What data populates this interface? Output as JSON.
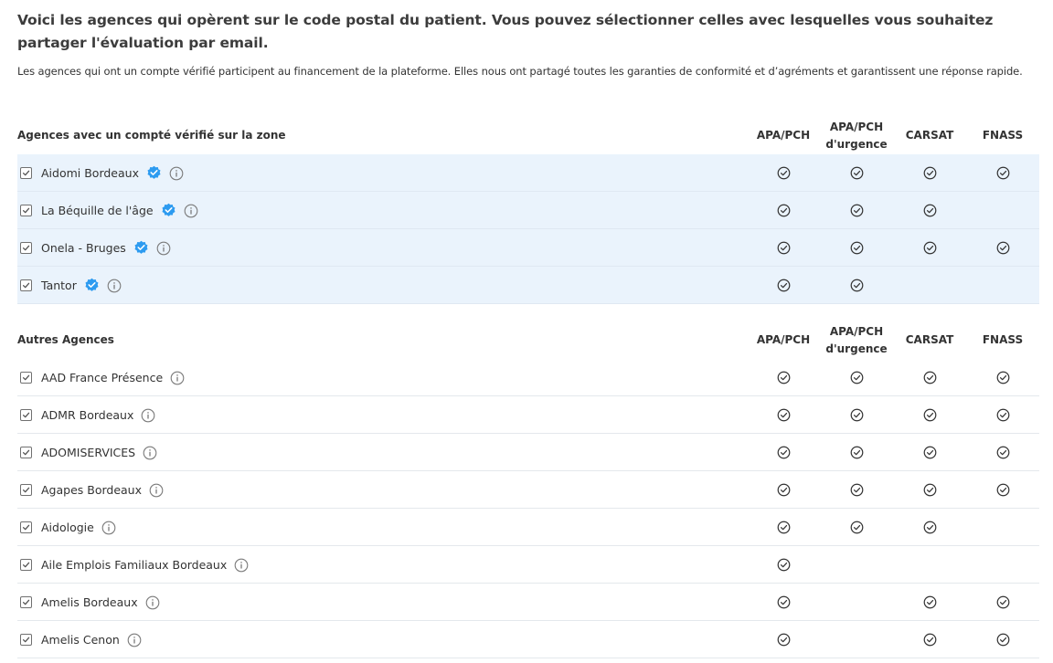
{
  "intro": {
    "title": "Voici les agences qui opèrent sur le code postal du patient. Vous pouvez sélectionner celles avec lesquelles vous souhaitez partager l'évaluation par email.",
    "text": "Les agences qui ont un compte vérifié participent au financement de la plateforme. Elles  nous ont partagé toutes les garanties de conformité et d’agréments et garantissent une réponse rapide."
  },
  "columns": [
    "APA/PCH",
    "APA/PCH d'urgence",
    "CARSAT",
    "FNASS"
  ],
  "verified_section": {
    "title": "Agences avec un compté vérifié sur la zone",
    "rows": [
      {
        "name": "Aidomi Bordeaux",
        "checked": true,
        "flags": [
          true,
          true,
          true,
          true
        ]
      },
      {
        "name": "La Béquille de l'âge",
        "checked": true,
        "flags": [
          true,
          true,
          true,
          false
        ]
      },
      {
        "name": "Onela - Bruges",
        "checked": true,
        "flags": [
          true,
          true,
          true,
          true
        ]
      },
      {
        "name": "Tantor",
        "checked": true,
        "flags": [
          true,
          true,
          false,
          false
        ]
      }
    ]
  },
  "other_section": {
    "title": "Autres Agences",
    "rows": [
      {
        "name": "AAD France Présence",
        "checked": true,
        "flags": [
          true,
          true,
          true,
          true
        ]
      },
      {
        "name": "ADMR Bordeaux",
        "checked": true,
        "flags": [
          true,
          true,
          true,
          true
        ]
      },
      {
        "name": "ADOMISERVICES",
        "checked": true,
        "flags": [
          true,
          true,
          true,
          true
        ]
      },
      {
        "name": "Agapes Bordeaux",
        "checked": true,
        "flags": [
          true,
          true,
          true,
          true
        ]
      },
      {
        "name": "Aidologie",
        "checked": true,
        "flags": [
          true,
          true,
          true,
          false
        ]
      },
      {
        "name": "Aile Emplois Familiaux Bordeaux",
        "checked": true,
        "flags": [
          true,
          false,
          false,
          false
        ]
      },
      {
        "name": "Amelis Bordeaux",
        "checked": true,
        "flags": [
          true,
          false,
          true,
          true
        ]
      },
      {
        "name": "Amelis Cenon",
        "checked": true,
        "flags": [
          true,
          false,
          true,
          true
        ]
      }
    ]
  },
  "colors": {
    "verified_row_bg": "#eaf3fc",
    "verified_badge": "#2d9bf0",
    "text": "#333333"
  },
  "icons": {
    "checkbox": "checkbox-checked-icon",
    "verified": "verified-badge-icon",
    "info": "info-icon",
    "available": "check-circle-icon"
  }
}
